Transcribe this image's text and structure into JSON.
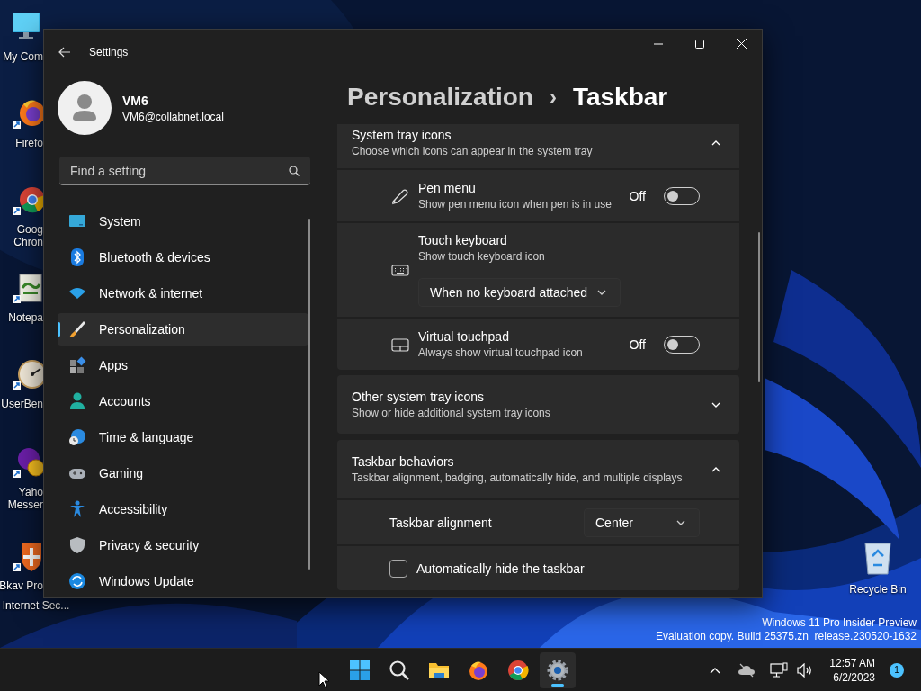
{
  "desktop": {
    "icons": [
      {
        "lines": [
          "My Com"
        ]
      },
      {
        "lines": [
          "Firefo"
        ]
      },
      {
        "lines": [
          "Goog",
          "Chron"
        ]
      },
      {
        "lines": [
          "Notepa"
        ]
      },
      {
        "lines": [
          "UserBen"
        ]
      },
      {
        "lines": [
          "Yaho",
          "Messer"
        ]
      },
      {
        "lines": [
          "Bkav Pro",
          "Internet Sec..."
        ]
      }
    ],
    "recycle_bin": {
      "label": "Recycle Bin"
    },
    "watermark": [
      "Windows 11 Pro Insider Preview",
      "Evaluation copy. Build 25375.zn_release.230520-1632"
    ]
  },
  "window": {
    "title": "Settings"
  },
  "account": {
    "name": "VM6",
    "email": "VM6@collabnet.local"
  },
  "search": {
    "placeholder": "Find a setting"
  },
  "nav": [
    {
      "label": "System",
      "selected": false
    },
    {
      "label": "Bluetooth & devices",
      "selected": false
    },
    {
      "label": "Network & internet",
      "selected": false
    },
    {
      "label": "Personalization",
      "selected": true
    },
    {
      "label": "Apps",
      "selected": false
    },
    {
      "label": "Accounts",
      "selected": false
    },
    {
      "label": "Time & language",
      "selected": false
    },
    {
      "label": "Gaming",
      "selected": false
    },
    {
      "label": "Accessibility",
      "selected": false
    },
    {
      "label": "Privacy & security",
      "selected": false
    },
    {
      "label": "Windows Update",
      "selected": false
    }
  ],
  "breadcrumb": {
    "parent": "Personalization",
    "separator": "›",
    "current": "Taskbar"
  },
  "sections": [
    {
      "title": "System tray icons",
      "subtitle": "Choose which icons can appear in the system tray",
      "expanded": true,
      "rows": [
        {
          "kind": "toggle",
          "label": "Pen menu",
          "description": "Show pen menu icon when pen is in use",
          "state_text": "Off",
          "on": false
        },
        {
          "kind": "dropdown",
          "label": "Touch keyboard",
          "description": "Show touch keyboard icon",
          "value": "When no keyboard attached"
        },
        {
          "kind": "toggle",
          "label": "Virtual touchpad",
          "description": "Always show virtual touchpad icon",
          "state_text": "Off",
          "on": false
        }
      ]
    },
    {
      "title": "Other system tray icons",
      "subtitle": "Show or hide additional system tray icons",
      "expanded": false
    },
    {
      "title": "Taskbar behaviors",
      "subtitle": "Taskbar alignment, badging, automatically hide, and multiple displays",
      "expanded": true,
      "rows": [
        {
          "kind": "select",
          "label": "Taskbar alignment",
          "value": "Center"
        },
        {
          "kind": "checkbox",
          "label": "Automatically hide the taskbar",
          "checked": false
        }
      ]
    }
  ],
  "taskbar": {
    "apps": [
      {
        "selected": false
      },
      {
        "selected": false
      },
      {
        "selected": false
      },
      {
        "selected": false
      },
      {
        "selected": false
      },
      {
        "selected": true
      }
    ],
    "clock": {
      "time": "12:57 AM",
      "date": "6/2/2023"
    },
    "notification_count": "1"
  }
}
